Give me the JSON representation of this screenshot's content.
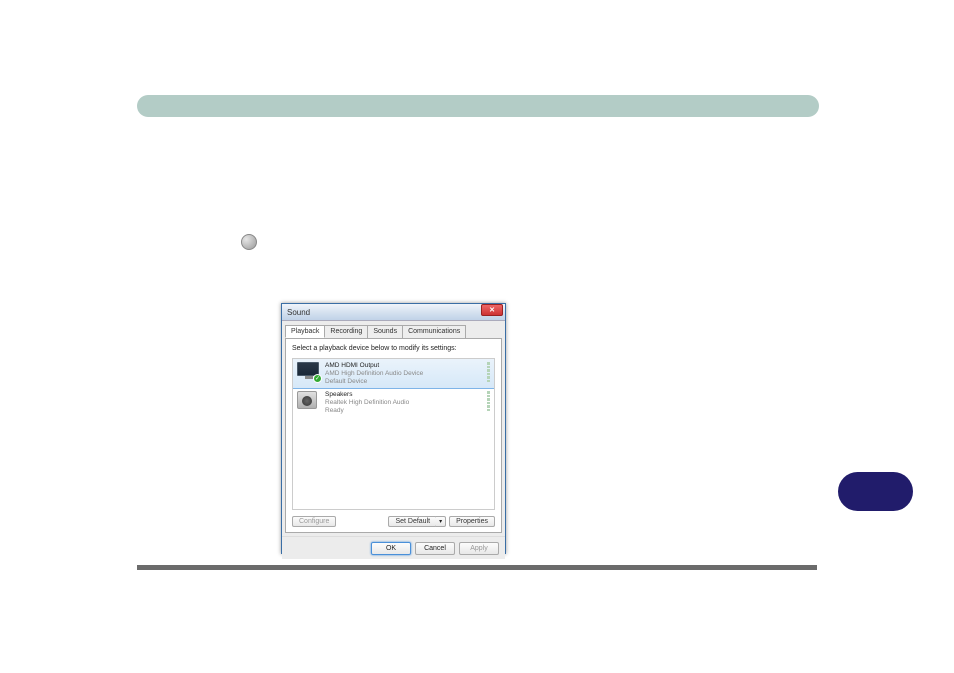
{
  "dialog": {
    "title": "Sound",
    "tabs": [
      "Playback",
      "Recording",
      "Sounds",
      "Communications"
    ],
    "instruction": "Select a playback device below to modify its settings:",
    "devices": [
      {
        "name": "AMD HDMI Output",
        "description": "AMD High Definition Audio Device",
        "status": "Default Device"
      },
      {
        "name": "Speakers",
        "description": "Realtek High Definition Audio",
        "status": "Ready"
      }
    ],
    "buttons": {
      "configure": "Configure",
      "set_default": "Set Default",
      "properties": "Properties",
      "ok": "OK",
      "cancel": "Cancel",
      "apply": "Apply"
    }
  }
}
